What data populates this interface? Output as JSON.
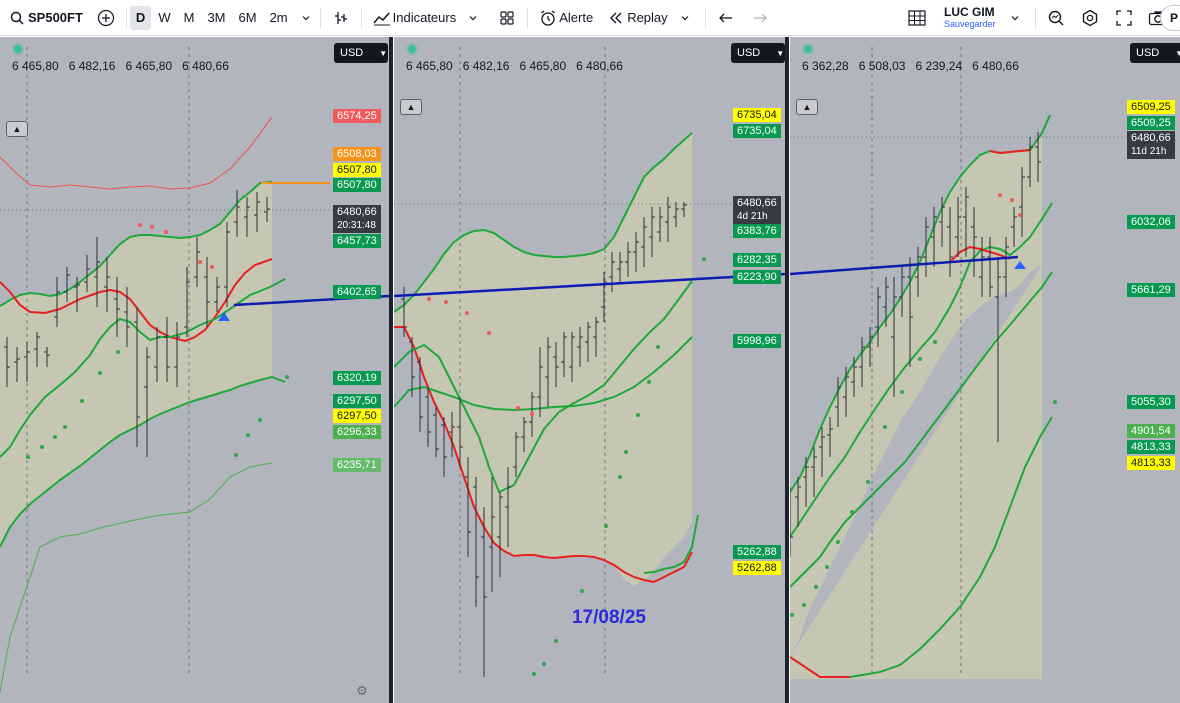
{
  "toolbar": {
    "symbol": "SP500FT",
    "timeframes": [
      "D",
      "W",
      "M",
      "3M",
      "6M",
      "2m"
    ],
    "active_timeframe": "D",
    "indicators_label": "Indicateurs",
    "alert_label": "Alerte",
    "replay_label": "Replay",
    "layout_name": "LUC GIM",
    "layout_status": "Sauvegarder",
    "publish_label": "P",
    "icons": [
      "search-icon",
      "add-symbol-icon",
      "chevron-down-icon",
      "bar-style-icon",
      "indicators-icon",
      "templates-icon",
      "alert-icon",
      "replay-icon",
      "undo-icon",
      "redo-icon",
      "layout-grid-icon",
      "quick-search-icon",
      "settings-icon",
      "fullscreen-icon",
      "snapshot-icon"
    ]
  },
  "panes": [
    {
      "currency": "USD",
      "legend": [
        "6 465,80",
        "6 482,16",
        "6 465,80",
        "6 480,66"
      ],
      "price_labels": [
        {
          "text": "6574,25",
          "bg": "#f05a5a"
        },
        {
          "text": "6508,03",
          "bg": "#f7931a"
        },
        {
          "text": "6507,80",
          "bg": "#ffff00",
          "fg": "#131722"
        },
        {
          "text": "6507,80",
          "bg": "#089950"
        },
        {
          "text": "6480,66",
          "sub": "20:31:48",
          "bg": "#363a45"
        },
        {
          "text": "6457,73",
          "bg": "#089950"
        },
        {
          "text": "6402,65",
          "bg": "#089950"
        },
        {
          "text": "6320,19",
          "bg": "#089950"
        },
        {
          "text": "6297,50",
          "bg": "#089950"
        },
        {
          "text": "6297,50",
          "bg": "#ffff00",
          "fg": "#131722"
        },
        {
          "text": "6296,33",
          "bg": "#4caf50"
        },
        {
          "text": "6235,71",
          "bg": "#66bb6a"
        }
      ]
    },
    {
      "currency": "USD",
      "legend": [
        "6 465,80",
        "6 482,16",
        "6 465,80",
        "6 480,66"
      ],
      "price_labels": [
        {
          "text": "6735,04",
          "bg": "#ffff00",
          "fg": "#131722"
        },
        {
          "text": "6735,04",
          "bg": "#089950"
        },
        {
          "text": "6480,66",
          "sub": "4d 21h",
          "bg": "#363a45"
        },
        {
          "text": "6383,76",
          "bg": "#089950"
        },
        {
          "text": "6282,35",
          "bg": "#089950"
        },
        {
          "text": "6223,90",
          "bg": "#089950"
        },
        {
          "text": "5998,96",
          "bg": "#089950"
        },
        {
          "text": "5262,88",
          "bg": "#089950"
        },
        {
          "text": "5262,88",
          "bg": "#ffff00",
          "fg": "#131722"
        }
      ],
      "annotation": "17/08/25"
    },
    {
      "currency": "USD",
      "legend": [
        "6 362,28",
        "6 508,03",
        "6 239,24",
        "6 480,66"
      ],
      "price_labels": [
        {
          "text": "6509,25",
          "bg": "#ffff00",
          "fg": "#131722"
        },
        {
          "text": "6509,25",
          "bg": "#089950"
        },
        {
          "text": "6480,66",
          "sub": "11d 21h",
          "bg": "#363a45"
        },
        {
          "text": "6032,06",
          "bg": "#089950"
        },
        {
          "text": "5661,29",
          "bg": "#089950"
        },
        {
          "text": "5055,30",
          "bg": "#089950"
        },
        {
          "text": "4901,54",
          "bg": "#4caf50"
        },
        {
          "text": "4813,33",
          "bg": "#089950"
        },
        {
          "text": "4813,33",
          "bg": "#ffff00",
          "fg": "#131722"
        }
      ]
    }
  ],
  "colors": {
    "pane_bg": "#b2b5be",
    "band_fill": "#c5c7b3",
    "band_green": "#1fa83a",
    "mid_red": "#e8201e",
    "trendline": "#0d1bb0",
    "candle": "#2a2e39"
  }
}
